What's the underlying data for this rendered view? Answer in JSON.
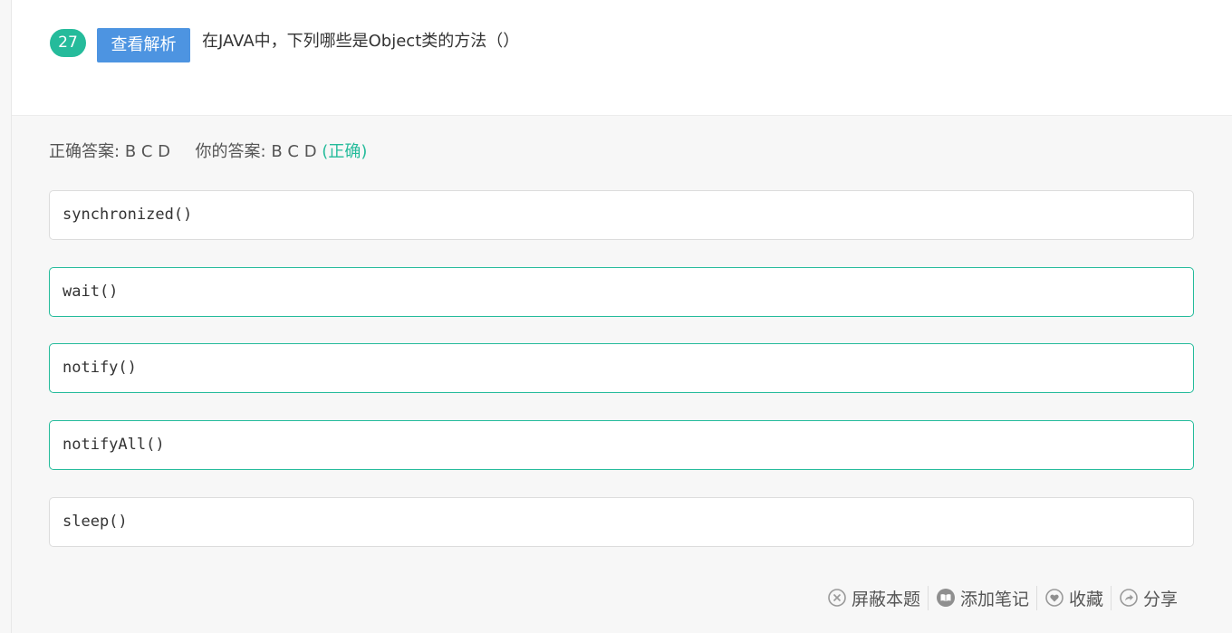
{
  "question": {
    "number": "27",
    "analysis_button": "查看解析",
    "text": "在JAVA中，下列哪些是Object类的方法（）"
  },
  "answer": {
    "correct_label": "正确答案:",
    "correct_value": "B C D",
    "your_label": "你的答案:",
    "your_value": "B C D",
    "status": "(正确)"
  },
  "options": [
    {
      "text": "synchronized()",
      "selected": false
    },
    {
      "text": "wait()",
      "selected": true
    },
    {
      "text": "notify()",
      "selected": true
    },
    {
      "text": "notifyAll()",
      "selected": true
    },
    {
      "text": "sleep()",
      "selected": false
    }
  ],
  "actions": {
    "hide": "屏蔽本题",
    "note": "添加笔记",
    "favorite": "收藏",
    "share": "分享"
  },
  "colors": {
    "accent": "#25bb9b",
    "button": "#4d94e1",
    "icon": "#9a9a9a"
  }
}
